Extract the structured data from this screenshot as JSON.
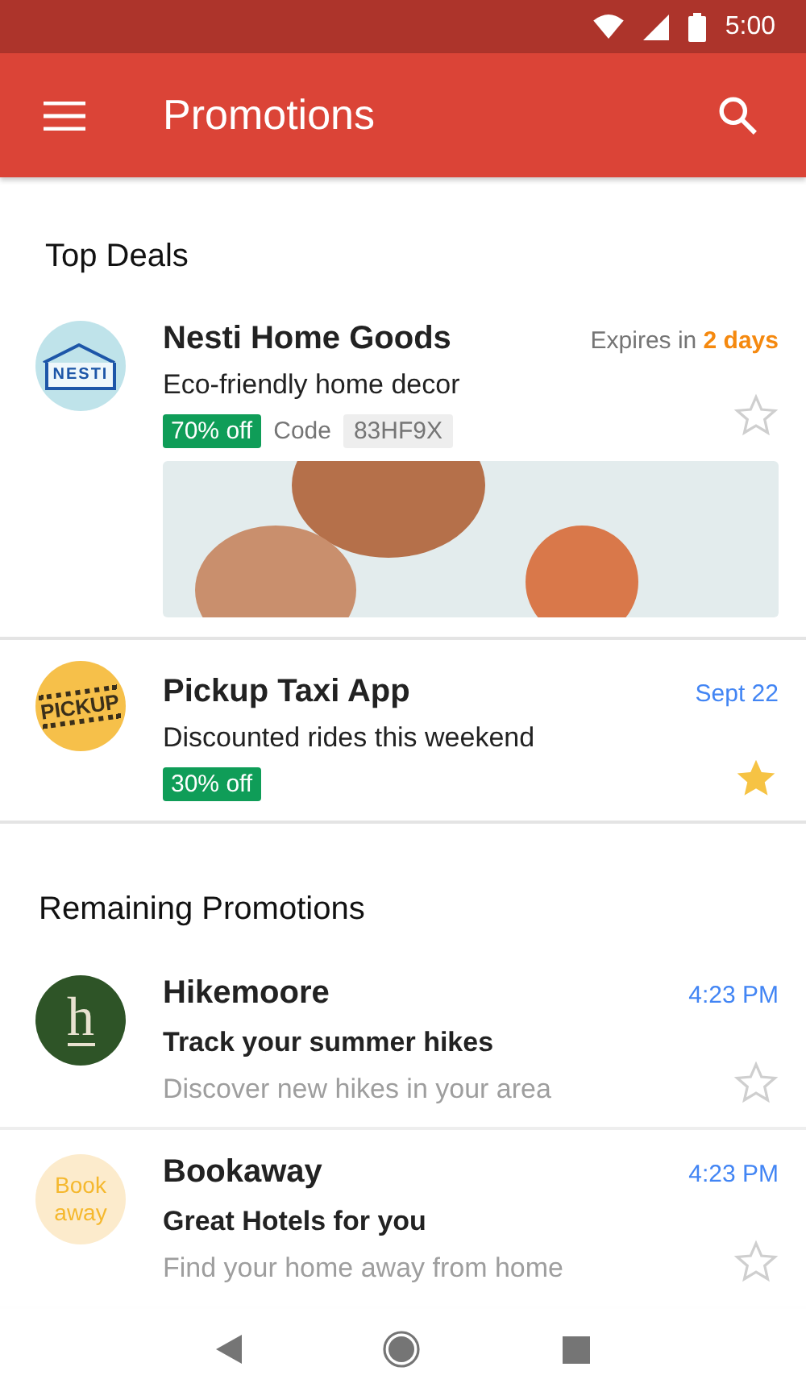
{
  "status_bar": {
    "time": "5:00"
  },
  "app_bar": {
    "title": "Promotions"
  },
  "sections": [
    {
      "title": "Top Deals",
      "kind": "deals",
      "items": [
        {
          "logo": {
            "kind": "nesti",
            "text": "NESTI"
          },
          "sender": "Nesti Home Goods",
          "subject": "Eco-friendly home decor",
          "discount": "70% off",
          "code_label": "Code",
          "code": "83HF9X",
          "expiry_prefix": "Expires in",
          "expiry_highlight": "2 days",
          "kind": "photo",
          "starred": false
        },
        {
          "logo": {
            "kind": "pickup",
            "text": "PICKUP"
          },
          "sender": "Pickup Taxi App",
          "subject": "Discounted rides this weekend",
          "discount": "30% off",
          "date": "Sept 22",
          "kind": "plain",
          "starred": true
        }
      ]
    },
    {
      "title": "Remaining Promotions",
      "kind": "list",
      "items": [
        {
          "logo": {
            "kind": "hike",
            "text": "h"
          },
          "sender": "Hikemoore",
          "subject": "Track your summer hikes",
          "snippet": "Discover new hikes in your area",
          "time": "4:23 PM",
          "starred": false
        },
        {
          "logo": {
            "kind": "book",
            "text": "Book away"
          },
          "sender": "Bookaway",
          "subject": "Great Hotels for you",
          "snippet": "Find your home away from home",
          "time": "4:23 PM",
          "starred": false
        }
      ]
    }
  ]
}
